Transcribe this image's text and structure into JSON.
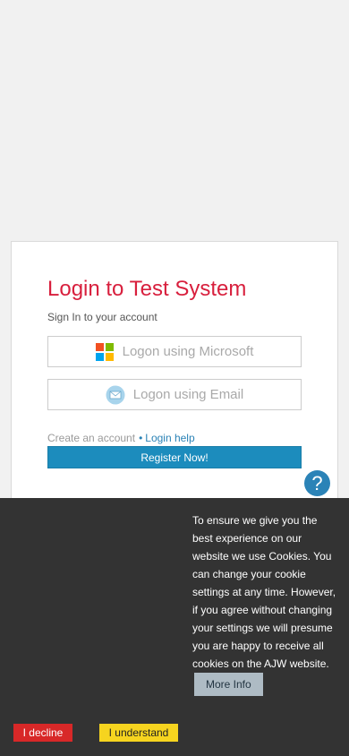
{
  "login": {
    "title": "Login to Test System",
    "subtitle": "Sign In to your account",
    "microsoft_label": "Logon using Microsoft",
    "email_label": "Logon using Email",
    "create_account": "Create an account",
    "bullet": "•",
    "login_help": "Login help",
    "register": "Register Now!"
  },
  "help_button": {
    "label": "?",
    "icon": "question-mark-icon"
  },
  "cookie": {
    "text": "To ensure we give you the best experience on our website we use Cookies. You can change your cookie settings at any time. However, if you agree without changing your settings we will presume you are happy to receive all cookies on the AJW website.",
    "more_info": "More Info",
    "decline": "I decline",
    "understand": "I understand"
  },
  "colors": {
    "title": "#d81f3d",
    "register_button": "#1c8cbd",
    "cookie_bar": "#333333",
    "decline": "#d82828",
    "understand": "#f6d41f",
    "ms_red": "#f25022",
    "ms_green": "#7fba00",
    "ms_blue": "#00a4ef",
    "ms_yellow": "#ffb900"
  }
}
